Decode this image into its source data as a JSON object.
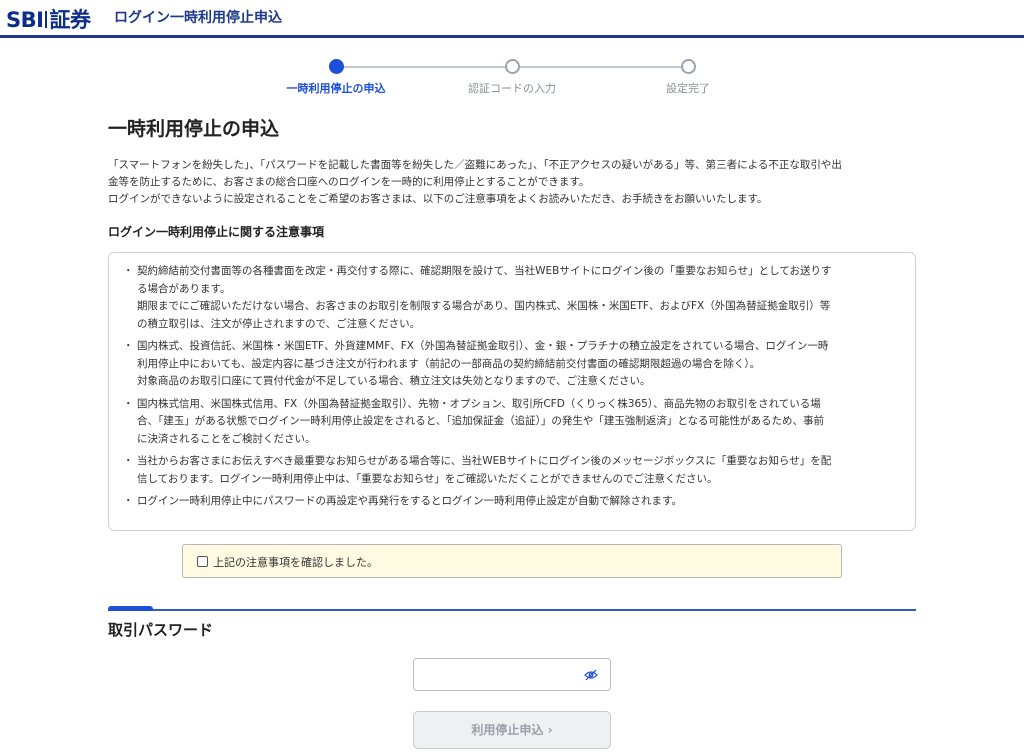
{
  "header": {
    "logo_text_left": "SBI",
    "logo_text_right": "証券",
    "title": "ログイン一時利用停止申込"
  },
  "stepper": {
    "steps": [
      {
        "label": "一時利用停止の申込",
        "active": true
      },
      {
        "label": "認証コードの入力",
        "active": false
      },
      {
        "label": "設定完了",
        "active": false
      }
    ]
  },
  "main": {
    "title": "一時利用停止の申込",
    "intro": [
      "「スマートフォンを紛失した」、「パスワードを記載した書面等を紛失した／盗難にあった」、「不正アクセスの疑いがある」等、第三者による不正な取引や出",
      "金等を防止するために、お客さまの総合口座へのログインを一時的に利用停止とすることができます。",
      "ログインができないように設定されることをご希望のお客さまは、以下のご注意事項をよくお読みいただき、お手続きをお願いいたします。"
    ],
    "notice_heading": "ログイン一時利用停止に関する注意事項",
    "notices": [
      [
        "契約締結前交付書面等の各種書面を改定・再交付する際に、確認期限を設けて、当社WEBサイトにログイン後の「重要なお知らせ」としてお送りす",
        "る場合があります。",
        "期限までにご確認いただけない場合、お客さまのお取引を制限する場合があり、国内株式、米国株・米国ETF、およびFX（外国為替証拠金取引）等",
        "の積立取引は、注文が停止されますので、ご注意ください。"
      ],
      [
        "国内株式、投資信託、米国株・米国ETF、外貨建MMF、FX（外国為替証拠金取引）、金・銀・プラチナの積立設定をされている場合、ログイン一時",
        "利用停止中においても、設定内容に基づき注文が行われます（前記の一部商品の契約締結前交付書面の確認期限超過の場合を除く）。",
        "対象商品のお取引口座にて買付代金が不足している場合、積立注文は失効となりますので、ご注意ください。"
      ],
      [
        "国内株式信用、米国株式信用、FX（外国為替証拠金取引）、先物・オプション、取引所CFD（くりっく株365）、商品先物のお取引をされている場",
        "合、「建玉」がある状態でログイン一時利用停止設定をされると、「追加保証金（追証）」の発生や「建玉強制返済」となる可能性があるため、事前",
        "に決済されることをご検討ください。"
      ],
      [
        "当社からお客さまにお伝えすべき最重要なお知らせがある場合等に、当社WEBサイトにログイン後のメッセージボックスに「重要なお知らせ」を配",
        "信しております。ログイン一時利用停止中は、「重要なお知らせ」をご確認いただくことができませんのでご注意ください。"
      ],
      [
        "ログイン一時利用停止中にパスワードの再設定や再発行をするとログイン一時利用停止設定が自動で解除されます。"
      ]
    ],
    "bullet": "・",
    "confirm_label": "上記の注意事項を確認しました。",
    "confirm_checked": false,
    "password_section_title": "取引パスワード",
    "password_value": "",
    "submit_label": "利用停止申込",
    "submit_chevron": "›"
  },
  "colors": {
    "brand": "#0b2e8a",
    "accent": "#1d4fd8",
    "confirm_bg": "#fffbe3",
    "disabled_btn_bg": "#eef0f2"
  }
}
